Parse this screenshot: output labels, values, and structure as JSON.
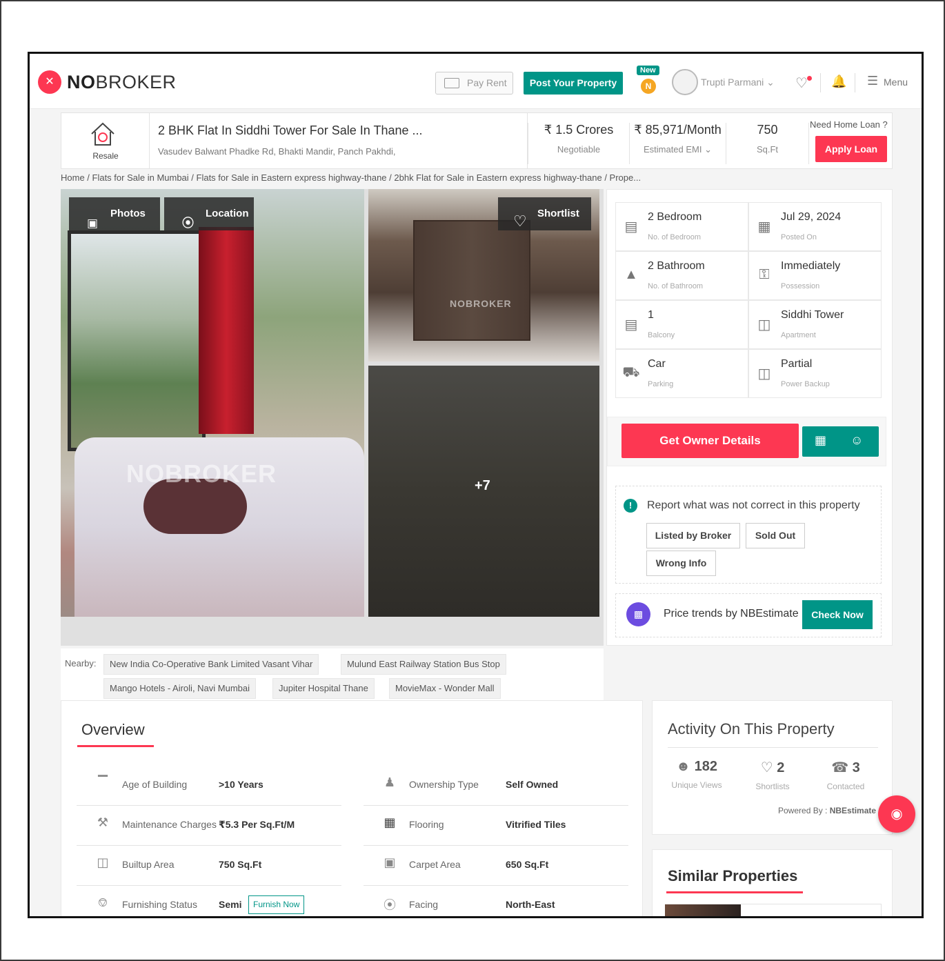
{
  "header": {
    "logo_bold": "NO",
    "logo_rest": "BROKER",
    "pay_rent": "Pay Rent",
    "post_property": "Post Your Property",
    "new_badge": "New",
    "n_badge": "N",
    "username": "Trupti Parmani",
    "menu": "Menu"
  },
  "summary": {
    "type_label": "Resale",
    "title": "2 BHK Flat In Siddhi Tower For Sale In Thane ...",
    "address": "Vasudev Balwant Phadke Rd, Bhakti Mandir, Panch Pakhdi,",
    "price": "₹ 1.5 Crores",
    "price_note": "Negotiable",
    "emi": "₹ 85,971/Month",
    "emi_label": "Estimated EMI",
    "area": "750",
    "area_unit": "Sq.Ft",
    "loan_question": "Need Home Loan ?",
    "apply_loan": "Apply Loan"
  },
  "breadcrumb": "Home / Flats for Sale in Mumbai / Flats for Sale in Eastern express highway-thane / 2bhk Flat for Sale in Eastern express highway-thane / Prope...",
  "gallery": {
    "photos_btn": "Photos",
    "location_btn": "Location",
    "shortlist_btn": "Shortlist",
    "more_count": "+7",
    "watermark": "NOBROKER"
  },
  "details": [
    {
      "value": "2 Bedroom",
      "label": "No. of Bedroom",
      "icon": "bed-icon"
    },
    {
      "value": "Jul 29, 2024",
      "label": "Posted On",
      "icon": "calendar-icon"
    },
    {
      "value": "2 Bathroom",
      "label": "No. of Bathroom",
      "icon": "bath-icon"
    },
    {
      "value": "Immediately",
      "label": "Possession",
      "icon": "key-icon"
    },
    {
      "value": "1",
      "label": "Balcony",
      "icon": "balcony-icon"
    },
    {
      "value": "Siddhi Tower",
      "label": "Apartment",
      "icon": "building-icon"
    },
    {
      "value": "Car",
      "label": "Parking",
      "icon": "car-icon"
    },
    {
      "value": "Partial",
      "label": "Power Backup",
      "icon": "battery-icon"
    }
  ],
  "actions": {
    "owner_details": "Get Owner Details",
    "report_title": "Report what was not correct in this property",
    "report_chips": [
      "Listed by Broker",
      "Sold Out",
      "Wrong Info"
    ],
    "price_trends": "Price trends by NBEstimate",
    "check_now": "Check Now"
  },
  "nearby": {
    "label": "Nearby:",
    "places": [
      "New India Co-Operative Bank Limited Vasant Vihar",
      "Mulund East Railway Station Bus Stop",
      "Mango Hotels - Airoli, Navi Mumbai",
      "Jupiter Hospital Thane",
      "MovieMax - Wonder Mall"
    ]
  },
  "overview": {
    "title": "Overview",
    "left": [
      {
        "label": "Age of Building",
        "value": ">10 Years",
        "icon": "cake-icon"
      },
      {
        "label": "Maintenance Charges",
        "value": "₹5.3 Per Sq.Ft/M",
        "icon": "tools-icon"
      },
      {
        "label": "Builtup Area",
        "value": "750 Sq.Ft",
        "icon": "area-building-icon"
      },
      {
        "label": "Furnishing Status",
        "value": "Semi",
        "icon": "sofa-icon"
      }
    ],
    "right": [
      {
        "label": "Ownership Type",
        "value": "Self Owned",
        "icon": "owner-icon"
      },
      {
        "label": "Flooring",
        "value": "Vitrified Tiles",
        "icon": "tiles-icon"
      },
      {
        "label": "Carpet Area",
        "value": "650 Sq.Ft",
        "icon": "carpet-icon"
      },
      {
        "label": "Facing",
        "value": "North-East",
        "icon": "compass-icon"
      }
    ],
    "furnish_now": "Furnish Now"
  },
  "activity": {
    "title": "Activity On This Property",
    "stats": [
      {
        "value": "182",
        "label": "Unique Views",
        "icon": "user-icon"
      },
      {
        "value": "2",
        "label": "Shortlists",
        "icon": "heart-icon"
      },
      {
        "value": "3",
        "label": "Contacted",
        "icon": "phone-icon"
      }
    ],
    "powered_by": "Powered By :",
    "powered_name": "NBEstimate"
  },
  "similar": {
    "title": "Similar Properties"
  },
  "colors": {
    "brand_red": "#fd3752",
    "teal": "#009587"
  }
}
